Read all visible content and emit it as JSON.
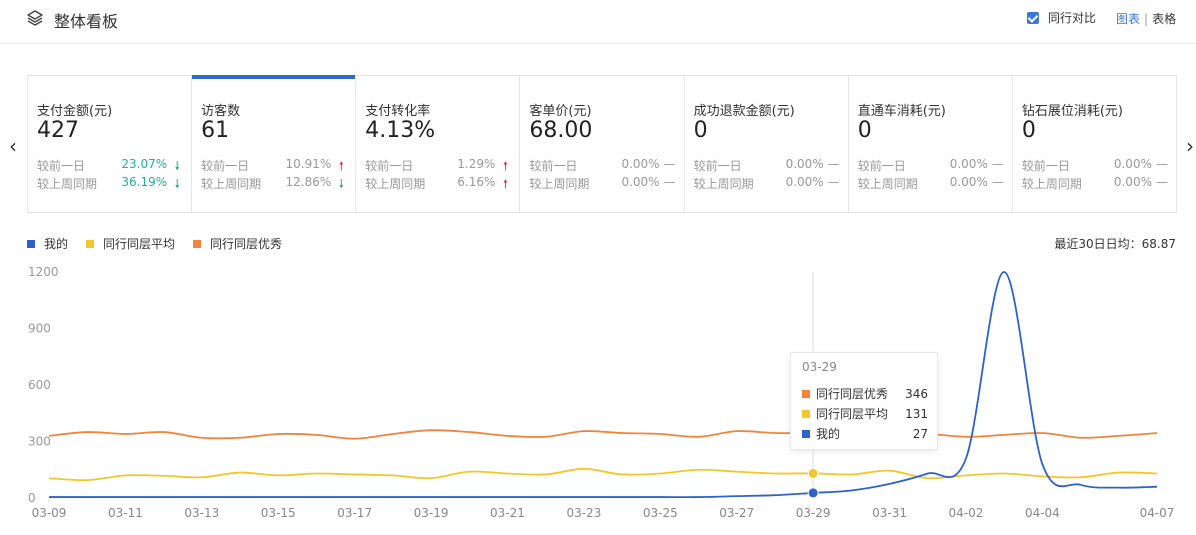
{
  "header": {
    "title": "整体看板",
    "compare_label": "同行对比",
    "view_chart": "图表",
    "view_sep": "|",
    "view_table": "表格"
  },
  "nav": {
    "prev": "‹",
    "next": "›"
  },
  "cards": [
    {
      "label": "支付金额(元)",
      "value": "427",
      "d_label": "较前一日",
      "d_value": "23.07%",
      "d_trend": "down",
      "w_label": "较上周同期",
      "w_value": "36.19%",
      "w_trend": "down"
    },
    {
      "label": "访客数",
      "value": "61",
      "d_label": "较前一日",
      "d_value": "10.91%",
      "d_trend": "up",
      "w_label": "较上周同期",
      "w_value": "12.86%",
      "w_trend": "down"
    },
    {
      "label": "支付转化率",
      "value": "4.13%",
      "d_label": "较前一日",
      "d_value": "1.29%",
      "d_trend": "up",
      "w_label": "较上周同期",
      "w_value": "6.16%",
      "w_trend": "up"
    },
    {
      "label": "客单价(元)",
      "value": "68.00",
      "d_label": "较前一日",
      "d_value": "0.00%",
      "d_trend": "flat",
      "w_label": "较上周同期",
      "w_value": "0.00%",
      "w_trend": "flat"
    },
    {
      "label": "成功退款金额(元)",
      "value": "0",
      "d_label": "较前一日",
      "d_value": "0.00%",
      "d_trend": "flat",
      "w_label": "较上周同期",
      "w_value": "0.00%",
      "w_trend": "flat"
    },
    {
      "label": "直通车消耗(元)",
      "value": "0",
      "d_label": "较前一日",
      "d_value": "0.00%",
      "d_trend": "flat",
      "w_label": "较上周同期",
      "w_value": "0.00%",
      "w_trend": "flat"
    },
    {
      "label": "钻石展位消耗(元)",
      "value": "0",
      "d_label": "较前一日",
      "d_value": "0.00%",
      "d_trend": "flat",
      "w_label": "较上周同期",
      "w_value": "0.00%",
      "w_trend": "flat"
    }
  ],
  "trend_glyphs": {
    "up": "🠕",
    "down": "🠗",
    "flat": "—"
  },
  "avg_text": "最近30日日均：68.87",
  "tooltip": {
    "date": "03-29",
    "rows": [
      {
        "name": "同行同层优秀",
        "value": "346",
        "color": "#f0843c"
      },
      {
        "name": "同行同层平均",
        "value": "131",
        "color": "#f3c72b"
      },
      {
        "name": "我的",
        "value": "27",
        "color": "#2d62c9"
      }
    ]
  },
  "chart_data": {
    "type": "line",
    "x": [
      "03-09",
      "03-10",
      "03-11",
      "03-12",
      "03-13",
      "03-14",
      "03-15",
      "03-16",
      "03-17",
      "03-18",
      "03-19",
      "03-20",
      "03-21",
      "03-22",
      "03-23",
      "03-24",
      "03-25",
      "03-26",
      "03-27",
      "03-28",
      "03-29",
      "03-30",
      "03-31",
      "04-01",
      "04-02",
      "04-03",
      "04-04",
      "04-05",
      "04-06",
      "04-07"
    ],
    "x_ticks": [
      "03-09",
      "03-11",
      "03-13",
      "03-15",
      "03-17",
      "03-19",
      "03-21",
      "03-23",
      "03-25",
      "03-27",
      "03-29",
      "03-31",
      "04-02",
      "04-04",
      "04-07"
    ],
    "y_ticks": [
      "1200",
      "900",
      "600",
      "300",
      "0"
    ],
    "ylim": [
      0,
      1200
    ],
    "series": [
      {
        "name": "我的",
        "color": "#2d62c9",
        "values": [
          5,
          5,
          5,
          5,
          5,
          5,
          5,
          5,
          5,
          5,
          5,
          5,
          5,
          5,
          5,
          5,
          5,
          5,
          10,
          15,
          27,
          40,
          75,
          130,
          210,
          1200,
          180,
          70,
          55,
          60
        ]
      },
      {
        "name": "同行同层平均",
        "color": "#f3c72b",
        "values": [
          105,
          95,
          120,
          118,
          110,
          135,
          120,
          130,
          125,
          120,
          105,
          140,
          130,
          125,
          155,
          125,
          130,
          150,
          140,
          130,
          131,
          125,
          145,
          105,
          120,
          130,
          115,
          110,
          135,
          130
        ]
      },
      {
        "name": "同行同层优秀",
        "color": "#f0843c",
        "values": [
          330,
          350,
          340,
          350,
          320,
          320,
          340,
          335,
          315,
          340,
          360,
          350,
          330,
          325,
          355,
          345,
          340,
          325,
          355,
          345,
          346,
          350,
          335,
          340,
          325,
          335,
          345,
          320,
          330,
          345
        ]
      }
    ],
    "highlight_index": 20,
    "legend_position": "top-left",
    "grid": false
  }
}
